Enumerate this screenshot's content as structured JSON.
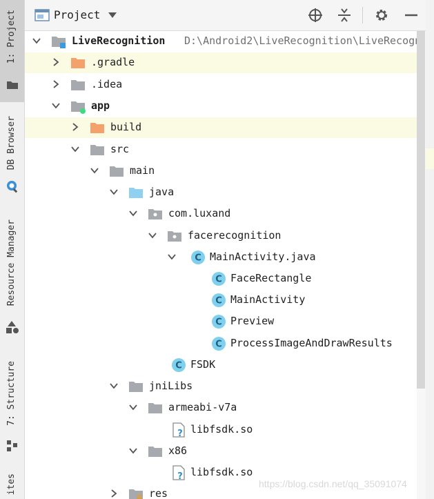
{
  "side_strip": {
    "project": "1: Project",
    "db_browser": "DB Browser",
    "resource_manager": "Resource Manager",
    "structure": "7: Structure",
    "favorites": "ites"
  },
  "header": {
    "title": "Project"
  },
  "tree": {
    "root": {
      "label": "LiveRecognition",
      "path": "D:\\Android2\\LiveRecognition\\LiveRecogni"
    },
    "gradle": ".gradle",
    "idea": ".idea",
    "app": "app",
    "build": "build",
    "src": "src",
    "main": "main",
    "java": "java",
    "pkg": "com.luxand",
    "subpkg": "facerecognition",
    "main_activity_java": "MainActivity.java",
    "face_rectangle": "FaceRectangle",
    "main_activity": "MainActivity",
    "preview": "Preview",
    "process_image": "ProcessImageAndDrawResults",
    "fsdk": "FSDK",
    "jnilibs": "jniLibs",
    "armeabi": "armeabi-v7a",
    "libfsdk1": "libfsdk.so",
    "x86": "x86",
    "libfsdk2": "libfsdk.so",
    "res": "res"
  },
  "watermark": "https://blog.csdn.net/qq_35091074",
  "colors": {
    "class_icon": "#7fd0ee",
    "folder_gray": "#a6a9ad",
    "folder_orange": "#f4a26b",
    "source_folder": "#8fd1ef",
    "highlight": "#fbfbe4"
  }
}
